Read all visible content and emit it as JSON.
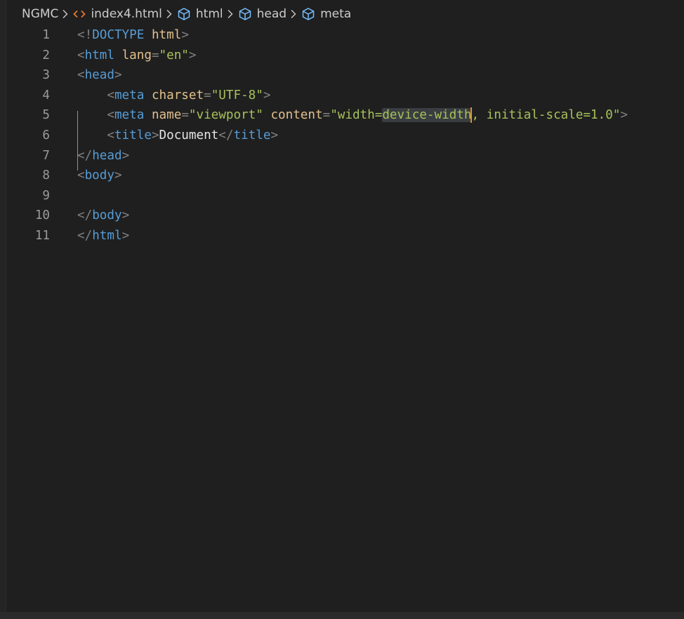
{
  "breadcrumb": {
    "items": [
      {
        "label": "NGMC",
        "icon": ""
      },
      {
        "label": "index4.html",
        "icon": "html-file-icon"
      },
      {
        "label": "html",
        "icon": "symbol-element-icon"
      },
      {
        "label": "head",
        "icon": "symbol-element-icon"
      },
      {
        "label": "meta",
        "icon": "symbol-element-icon"
      }
    ]
  },
  "editor": {
    "lines": [
      {
        "number": "1",
        "text": "<!DOCTYPE html>"
      },
      {
        "number": "2",
        "text": "<html lang=\"en\">"
      },
      {
        "number": "3",
        "text": "<head>"
      },
      {
        "number": "4",
        "text": "    <meta charset=\"UTF-8\">"
      },
      {
        "number": "5",
        "text": "    <meta name=\"viewport\" content=\"width=device-width, initial-scale=1.0\">"
      },
      {
        "number": "6",
        "text": "    <title>Document</title>"
      },
      {
        "number": "7",
        "text": "</head>"
      },
      {
        "number": "8",
        "text": "<body>"
      },
      {
        "number": "9",
        "text": ""
      },
      {
        "number": "10",
        "text": "</body>"
      },
      {
        "number": "11",
        "text": "</html>"
      }
    ],
    "selection": "device-width"
  },
  "colors": {
    "background": "#1f1f1f",
    "tag": "#569cd6",
    "attribute": "#e2c08d",
    "string": "#a6c25a",
    "line_number": "#9a9a9a",
    "cursor": "#e8882b"
  }
}
